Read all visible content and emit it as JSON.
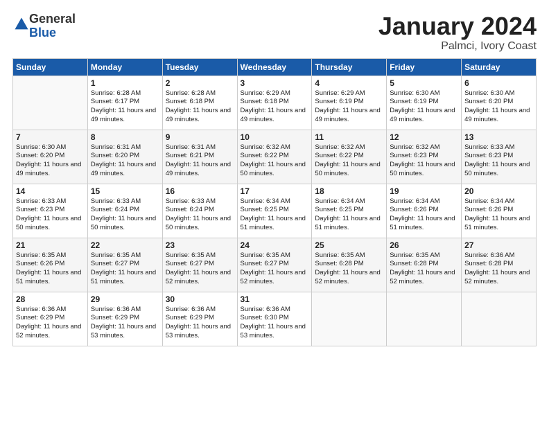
{
  "logo": {
    "general": "General",
    "blue": "Blue"
  },
  "title": "January 2024",
  "subtitle": "Palmci, Ivory Coast",
  "headers": [
    "Sunday",
    "Monday",
    "Tuesday",
    "Wednesday",
    "Thursday",
    "Friday",
    "Saturday"
  ],
  "weeks": [
    [
      {
        "day": "",
        "sunrise": "",
        "sunset": "",
        "daylight": ""
      },
      {
        "day": "1",
        "sunrise": "Sunrise: 6:28 AM",
        "sunset": "Sunset: 6:17 PM",
        "daylight": "Daylight: 11 hours and 49 minutes."
      },
      {
        "day": "2",
        "sunrise": "Sunrise: 6:28 AM",
        "sunset": "Sunset: 6:18 PM",
        "daylight": "Daylight: 11 hours and 49 minutes."
      },
      {
        "day": "3",
        "sunrise": "Sunrise: 6:29 AM",
        "sunset": "Sunset: 6:18 PM",
        "daylight": "Daylight: 11 hours and 49 minutes."
      },
      {
        "day": "4",
        "sunrise": "Sunrise: 6:29 AM",
        "sunset": "Sunset: 6:19 PM",
        "daylight": "Daylight: 11 hours and 49 minutes."
      },
      {
        "day": "5",
        "sunrise": "Sunrise: 6:30 AM",
        "sunset": "Sunset: 6:19 PM",
        "daylight": "Daylight: 11 hours and 49 minutes."
      },
      {
        "day": "6",
        "sunrise": "Sunrise: 6:30 AM",
        "sunset": "Sunset: 6:20 PM",
        "daylight": "Daylight: 11 hours and 49 minutes."
      }
    ],
    [
      {
        "day": "7",
        "sunrise": "Sunrise: 6:30 AM",
        "sunset": "Sunset: 6:20 PM",
        "daylight": "Daylight: 11 hours and 49 minutes."
      },
      {
        "day": "8",
        "sunrise": "Sunrise: 6:31 AM",
        "sunset": "Sunset: 6:20 PM",
        "daylight": "Daylight: 11 hours and 49 minutes."
      },
      {
        "day": "9",
        "sunrise": "Sunrise: 6:31 AM",
        "sunset": "Sunset: 6:21 PM",
        "daylight": "Daylight: 11 hours and 49 minutes."
      },
      {
        "day": "10",
        "sunrise": "Sunrise: 6:32 AM",
        "sunset": "Sunset: 6:22 PM",
        "daylight": "Daylight: 11 hours and 50 minutes."
      },
      {
        "day": "11",
        "sunrise": "Sunrise: 6:32 AM",
        "sunset": "Sunset: 6:22 PM",
        "daylight": "Daylight: 11 hours and 50 minutes."
      },
      {
        "day": "12",
        "sunrise": "Sunrise: 6:32 AM",
        "sunset": "Sunset: 6:23 PM",
        "daylight": "Daylight: 11 hours and 50 minutes."
      },
      {
        "day": "13",
        "sunrise": "Sunrise: 6:33 AM",
        "sunset": "Sunset: 6:23 PM",
        "daylight": "Daylight: 11 hours and 50 minutes."
      }
    ],
    [
      {
        "day": "14",
        "sunrise": "Sunrise: 6:33 AM",
        "sunset": "Sunset: 6:23 PM",
        "daylight": "Daylight: 11 hours and 50 minutes."
      },
      {
        "day": "15",
        "sunrise": "Sunrise: 6:33 AM",
        "sunset": "Sunset: 6:24 PM",
        "daylight": "Daylight: 11 hours and 50 minutes."
      },
      {
        "day": "16",
        "sunrise": "Sunrise: 6:33 AM",
        "sunset": "Sunset: 6:24 PM",
        "daylight": "Daylight: 11 hours and 50 minutes."
      },
      {
        "day": "17",
        "sunrise": "Sunrise: 6:34 AM",
        "sunset": "Sunset: 6:25 PM",
        "daylight": "Daylight: 11 hours and 51 minutes."
      },
      {
        "day": "18",
        "sunrise": "Sunrise: 6:34 AM",
        "sunset": "Sunset: 6:25 PM",
        "daylight": "Daylight: 11 hours and 51 minutes."
      },
      {
        "day": "19",
        "sunrise": "Sunrise: 6:34 AM",
        "sunset": "Sunset: 6:26 PM",
        "daylight": "Daylight: 11 hours and 51 minutes."
      },
      {
        "day": "20",
        "sunrise": "Sunrise: 6:34 AM",
        "sunset": "Sunset: 6:26 PM",
        "daylight": "Daylight: 11 hours and 51 minutes."
      }
    ],
    [
      {
        "day": "21",
        "sunrise": "Sunrise: 6:35 AM",
        "sunset": "Sunset: 6:26 PM",
        "daylight": "Daylight: 11 hours and 51 minutes."
      },
      {
        "day": "22",
        "sunrise": "Sunrise: 6:35 AM",
        "sunset": "Sunset: 6:27 PM",
        "daylight": "Daylight: 11 hours and 51 minutes."
      },
      {
        "day": "23",
        "sunrise": "Sunrise: 6:35 AM",
        "sunset": "Sunset: 6:27 PM",
        "daylight": "Daylight: 11 hours and 52 minutes."
      },
      {
        "day": "24",
        "sunrise": "Sunrise: 6:35 AM",
        "sunset": "Sunset: 6:27 PM",
        "daylight": "Daylight: 11 hours and 52 minutes."
      },
      {
        "day": "25",
        "sunrise": "Sunrise: 6:35 AM",
        "sunset": "Sunset: 6:28 PM",
        "daylight": "Daylight: 11 hours and 52 minutes."
      },
      {
        "day": "26",
        "sunrise": "Sunrise: 6:35 AM",
        "sunset": "Sunset: 6:28 PM",
        "daylight": "Daylight: 11 hours and 52 minutes."
      },
      {
        "day": "27",
        "sunrise": "Sunrise: 6:36 AM",
        "sunset": "Sunset: 6:28 PM",
        "daylight": "Daylight: 11 hours and 52 minutes."
      }
    ],
    [
      {
        "day": "28",
        "sunrise": "Sunrise: 6:36 AM",
        "sunset": "Sunset: 6:29 PM",
        "daylight": "Daylight: 11 hours and 52 minutes."
      },
      {
        "day": "29",
        "sunrise": "Sunrise: 6:36 AM",
        "sunset": "Sunset: 6:29 PM",
        "daylight": "Daylight: 11 hours and 53 minutes."
      },
      {
        "day": "30",
        "sunrise": "Sunrise: 6:36 AM",
        "sunset": "Sunset: 6:29 PM",
        "daylight": "Daylight: 11 hours and 53 minutes."
      },
      {
        "day": "31",
        "sunrise": "Sunrise: 6:36 AM",
        "sunset": "Sunset: 6:30 PM",
        "daylight": "Daylight: 11 hours and 53 minutes."
      },
      {
        "day": "",
        "sunrise": "",
        "sunset": "",
        "daylight": ""
      },
      {
        "day": "",
        "sunrise": "",
        "sunset": "",
        "daylight": ""
      },
      {
        "day": "",
        "sunrise": "",
        "sunset": "",
        "daylight": ""
      }
    ]
  ]
}
